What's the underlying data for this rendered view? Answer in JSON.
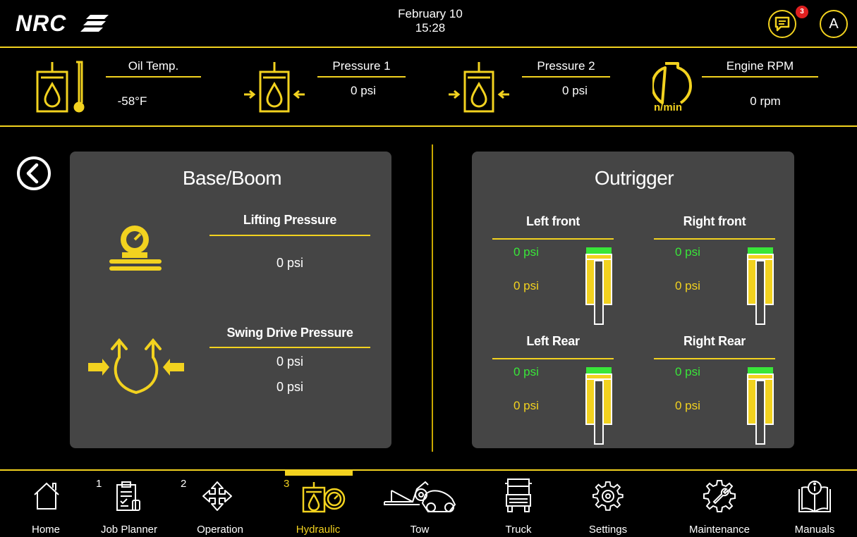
{
  "header": {
    "logo_text": "NRC",
    "date": "February 10",
    "time": "15:28",
    "message_badge": "3",
    "avatar": "A"
  },
  "gauges": [
    {
      "label": "Oil Temp.",
      "value": "-58°F",
      "icon": "oil-temp-icon"
    },
    {
      "label": "Pressure 1",
      "value": "0 psi",
      "icon": "pressure-icon"
    },
    {
      "label": "Pressure 2",
      "value": "0 psi",
      "icon": "pressure-icon"
    },
    {
      "label": "Engine RPM",
      "value": "0 rpm",
      "icon": "engine-rpm-icon",
      "icon_text": "n/min"
    }
  ],
  "base_boom": {
    "title": "Base/Boom",
    "lifting": {
      "label": "Lifting Pressure",
      "value": "0 psi"
    },
    "swing": {
      "label": "Swing Drive Pressure",
      "value1": "0 psi",
      "value2": "0 psi"
    }
  },
  "outrigger": {
    "title": "Outrigger",
    "items": [
      {
        "label": "Left front",
        "top": "0 psi",
        "bottom": "0 psi"
      },
      {
        "label": "Right front",
        "top": "0 psi",
        "bottom": "0 psi"
      },
      {
        "label": "Left Rear",
        "top": "0 psi",
        "bottom": "0 psi"
      },
      {
        "label": "Right Rear",
        "top": "0 psi",
        "bottom": "0 psi"
      }
    ]
  },
  "nav": [
    {
      "label": "Home",
      "num": ""
    },
    {
      "label": "Job Planner",
      "num": "1"
    },
    {
      "label": "Operation",
      "num": "2"
    },
    {
      "label": "Hydraulic",
      "num": "3",
      "active": true
    },
    {
      "label": "Tow",
      "num": ""
    },
    {
      "label": "Truck",
      "num": ""
    },
    {
      "label": "Settings",
      "num": ""
    },
    {
      "label": "Maintenance",
      "num": ""
    },
    {
      "label": "Manuals",
      "num": ""
    }
  ],
  "colors": {
    "accent": "#f2d21f",
    "panel": "#454545",
    "green": "#39e639",
    "badge": "#e02020"
  }
}
